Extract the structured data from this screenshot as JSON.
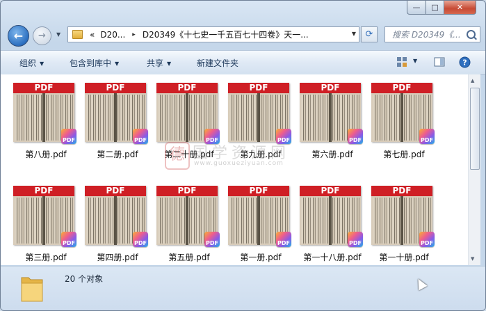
{
  "window_controls": {
    "minimize": "—",
    "maximize": "□",
    "close": "✕"
  },
  "nav": {
    "back_glyph": "←",
    "forward_glyph": "→",
    "history_glyph": "▼",
    "breadcrumb": {
      "overflow": "«",
      "root": "D20...",
      "separator": "▸",
      "current": "D20349《十七史一千五百七十四卷》天一..."
    },
    "refresh_glyph": "⟳",
    "search_placeholder": "搜索 D20349《..."
  },
  "toolbar": {
    "organize": "组织",
    "include_in_library": "包含到库中",
    "share": "共享",
    "new_folder": "新建文件夹",
    "help": "?"
  },
  "file_badge": "PDF",
  "pdf_bar_label": "PDF",
  "files": [
    {
      "name": "第八册.pdf"
    },
    {
      "name": "第二册.pdf"
    },
    {
      "name": "第二十册.pdf"
    },
    {
      "name": "第九册.pdf"
    },
    {
      "name": "第六册.pdf"
    },
    {
      "name": "第七册.pdf"
    },
    {
      "name": "第三册.pdf"
    },
    {
      "name": "第四册.pdf"
    },
    {
      "name": "第五册.pdf"
    },
    {
      "name": "第一册.pdf"
    },
    {
      "name": "第一十八册.pdf"
    },
    {
      "name": "第一十册.pdf"
    }
  ],
  "watermark": {
    "seal": "德",
    "text": "国学资源网",
    "url": "www.guoxueziyuan.com"
  },
  "status": {
    "count_text": "20 个对象"
  },
  "colors": {
    "pdf_red": "#cf1f25",
    "accent": "#2b6fc0"
  }
}
